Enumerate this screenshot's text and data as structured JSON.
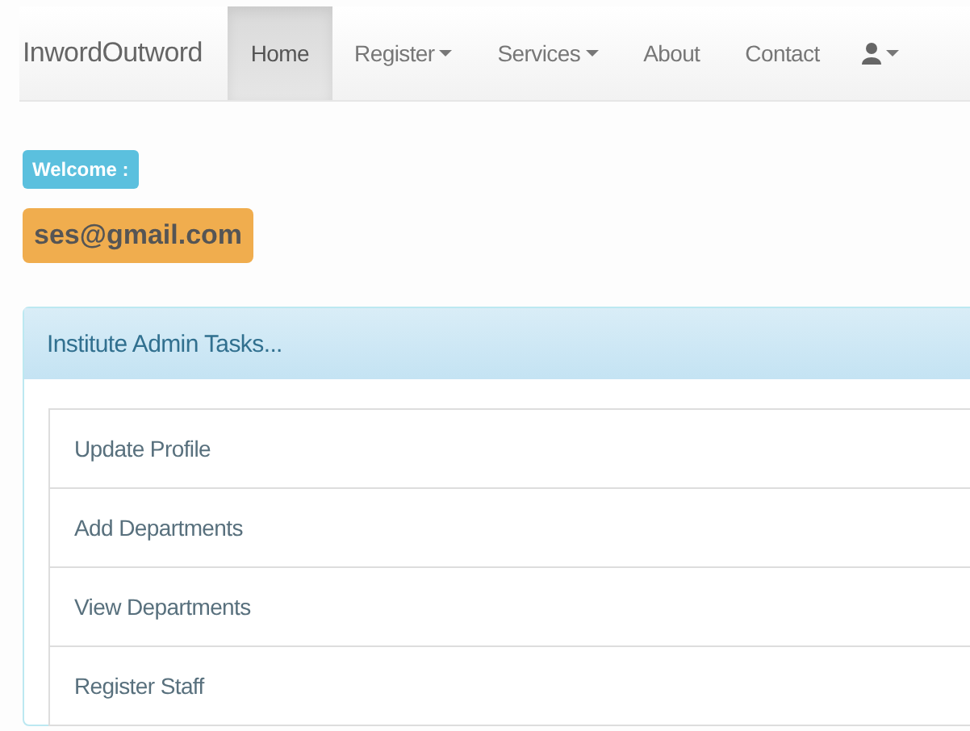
{
  "navbar": {
    "brand": "InwordOutword",
    "items": [
      {
        "label": "Home",
        "selected": true,
        "dropdown": false
      },
      {
        "label": "Register",
        "selected": false,
        "dropdown": true
      },
      {
        "label": "Services",
        "selected": false,
        "dropdown": true
      },
      {
        "label": "About",
        "selected": false,
        "dropdown": false
      },
      {
        "label": "Contact",
        "selected": false,
        "dropdown": false
      }
    ],
    "user_menu": {
      "dropdown": true
    }
  },
  "welcome_label": "Welcome :",
  "email_label": "ses@gmail.com",
  "panel": {
    "title": "Institute Admin Tasks...",
    "tasks": [
      "Update Profile",
      "Add Departments",
      "View Departments",
      "Register Staff"
    ]
  }
}
